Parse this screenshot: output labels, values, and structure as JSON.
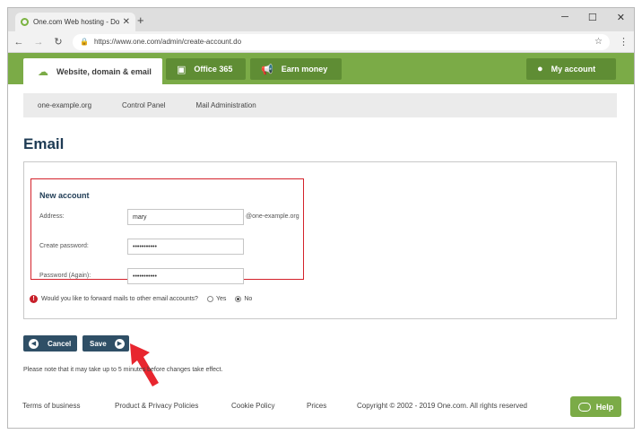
{
  "browser": {
    "tab_title": "One.com Web hosting - Domai",
    "tab_close": "✕",
    "new_tab": "+",
    "url": "https://www.one.com/admin/create-account.do",
    "controls": {
      "minimize": "─",
      "maximize": "☐",
      "close": "✕"
    }
  },
  "header": {
    "tabs": [
      {
        "label": "Website, domain & email",
        "icon": "cloud-icon"
      },
      {
        "label": "Office 365",
        "icon": "office-icon"
      },
      {
        "label": "Earn money",
        "icon": "megaphone-icon"
      }
    ],
    "account_label": "My account"
  },
  "breadcrumb": [
    "one-example.org",
    "Control Panel",
    "Mail Administration"
  ],
  "page_title": "Email",
  "form": {
    "section_title": "New account",
    "address_label": "Address:",
    "address_value": "mary",
    "domain_suffix": "@one-example.org",
    "password_label": "Create password:",
    "password_value": "•••••••••••",
    "password_again_label": "Password (Again):",
    "password_again_value": "•••••••••••",
    "forward_question": "Would you like to forward mails to other email accounts?",
    "yes_label": "Yes",
    "no_label": "No",
    "selected": "No"
  },
  "buttons": {
    "cancel": "Cancel",
    "save": "Save"
  },
  "note": "Please note that it may take up to 5 minutes before changes take effect.",
  "footer": {
    "links": [
      "Terms of business",
      "Product & Privacy Policies",
      "Cookie Policy",
      "Prices"
    ],
    "copyright": "Copyright © 2002 - 2019 One.com. All rights reserved"
  },
  "help_label": "Help",
  "colors": {
    "brand_green": "#7bab47",
    "navy": "#2f4f66",
    "highlight_red": "#d4222b"
  }
}
